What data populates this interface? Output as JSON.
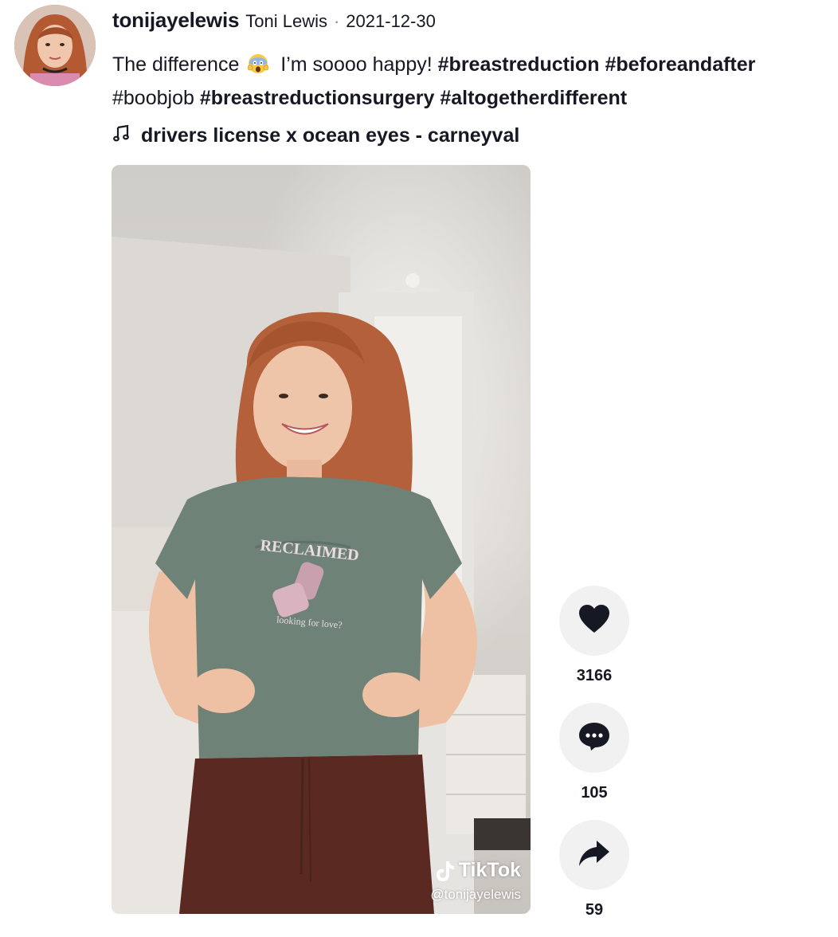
{
  "author": {
    "username": "tonijayelewis",
    "nickname": "Toni Lewis",
    "separator": "·",
    "date": "2021-12-30"
  },
  "caption": {
    "text_before": "The difference",
    "emoji_icon": "screaming-face-emoji",
    "text_after": "I’m soooo happy!",
    "hashtags": [
      "#breastreduction",
      "#beforeandafter",
      "#boobjob",
      "#breastreductionsurgery",
      "#altogetherdifferent"
    ]
  },
  "music": {
    "icon": "music-note-icon",
    "title": "drivers license x ocean eyes - carneyval"
  },
  "video": {
    "watermark_brand": "TikTok",
    "watermark_handle": "@tonijayelewis",
    "shirt_text_top": "RECLAIMED",
    "shirt_text_bottom": "looking for love?"
  },
  "actions": {
    "likes": "3166",
    "comments": "105",
    "shares": "59"
  },
  "colors": {
    "text": "#161823",
    "button_bg": "#f1f1f2",
    "shirt": "#6e8278",
    "pants": "#5a2a22",
    "hair": "#b4603a"
  }
}
